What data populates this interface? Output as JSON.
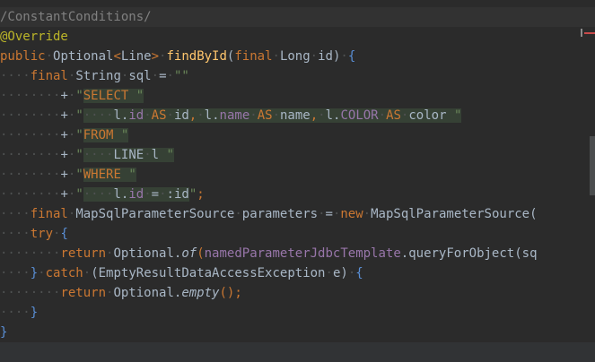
{
  "editor": {
    "lines": [
      [
        "/ConstantConditions/"
      ],
      [
        "@Override"
      ],
      [
        "public",
        " ",
        "Optional",
        "<",
        "Line",
        ">",
        " ",
        "findById",
        "(",
        "final",
        " ",
        "Long",
        " ",
        "id",
        ")",
        " ",
        "{"
      ],
      [
        "final",
        " ",
        "String",
        " ",
        "sql",
        " ",
        "=",
        " ",
        "\"\""
      ],
      [
        "+",
        " ",
        "\"",
        "SELECT",
        " \""
      ],
      [
        "+",
        " ",
        "\"",
        "l",
        ".",
        "id",
        " ",
        "AS",
        " ",
        "id",
        ",",
        " ",
        "l",
        ".",
        "name",
        " ",
        "AS",
        " ",
        "name",
        ",",
        " ",
        "l",
        ".",
        "COLOR",
        " ",
        "AS",
        " ",
        "color",
        " \""
      ],
      [
        "+",
        " ",
        "\"",
        "FROM",
        " \""
      ],
      [
        "+",
        " ",
        "\"",
        "LINE",
        " ",
        "l",
        " \""
      ],
      [
        "+",
        " ",
        "\"",
        "WHERE",
        " \""
      ],
      [
        "+",
        " ",
        "\"",
        "l",
        ".",
        "id",
        " ",
        "=",
        " ",
        ":id",
        "\"",
        ";"
      ],
      [
        "final",
        " ",
        "MapSqlParameterSource",
        " ",
        "parameters",
        " ",
        "=",
        " ",
        "new",
        " ",
        "MapSqlParameterSource",
        "("
      ],
      [
        "try",
        " ",
        "{"
      ],
      [
        "return",
        " ",
        "Optional",
        ".",
        "of",
        "(",
        "namedParameterJdbcTemplate",
        ".",
        "queryForObject",
        "(",
        "sq"
      ],
      [
        "}",
        " ",
        "catch",
        " ",
        "(",
        "EmptyResultDataAccessException",
        " ",
        "e",
        ")",
        " ",
        "{"
      ],
      [
        "return",
        " ",
        "Optional",
        ".",
        "empty",
        "(",
        ")",
        ";"
      ],
      [
        "}"
      ],
      [
        "}"
      ]
    ]
  },
  "colors": {
    "background": "#2b2b2b",
    "keyword": "#cc7832",
    "string": "#6a8759",
    "annotation": "#bbb529",
    "method": "#ffc66d",
    "identifier": "#a9b7c6",
    "field": "#9876aa",
    "comment": "#808080",
    "sql_injection_bg": "#364135"
  }
}
